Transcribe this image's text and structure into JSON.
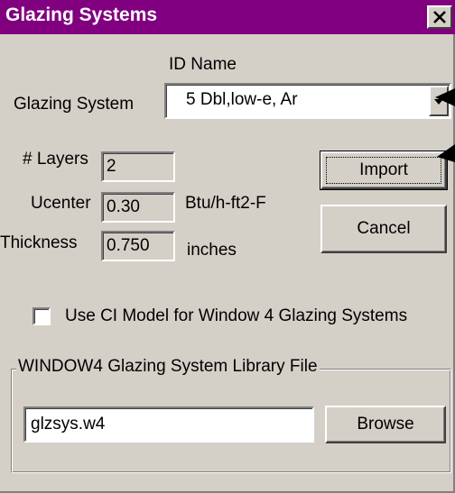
{
  "window": {
    "title": "Glazing Systems",
    "close_label": "✕"
  },
  "header": {
    "id_name_label": "ID Name"
  },
  "glazing_system": {
    "label": "Glazing System",
    "selected": "5 Dbl,low-e, Ar"
  },
  "fields": {
    "layers_label": "# Layers",
    "layers_value": "2",
    "ucenter_label": "Ucenter",
    "ucenter_value": "0.30",
    "ucenter_unit": "Btu/h-ft2-F",
    "thickness_label": "Thickness",
    "thickness_value": "0.750",
    "thickness_unit": "inches"
  },
  "buttons": {
    "import_label": "Import",
    "cancel_label": "Cancel",
    "browse_label": "Browse"
  },
  "checkbox": {
    "label": "Use CI Model for Window 4 Glazing Systems",
    "checked": false
  },
  "library": {
    "group_label": "WINDOW4 Glazing System Library File",
    "file_value": "glzsys.w4"
  },
  "colors": {
    "titlebar": "#800080",
    "face": "#d4d0c8"
  },
  "icons": [
    "close-icon",
    "dropdown-arrow-icon",
    "pointer-arrow-icon"
  ]
}
